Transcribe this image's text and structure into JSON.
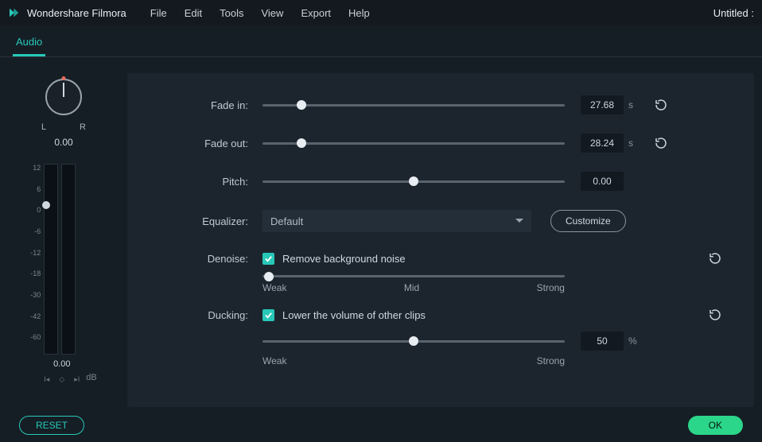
{
  "app": {
    "name": "Wondershare Filmora",
    "doc_title": "Untitled :"
  },
  "menu": [
    "File",
    "Edit",
    "Tools",
    "View",
    "Export",
    "Help"
  ],
  "tab": {
    "label": "Audio"
  },
  "pan": {
    "left": "L",
    "right": "R",
    "value": "0.00"
  },
  "meter": {
    "ticks": [
      "12",
      "6",
      "0",
      "-6",
      "-12",
      "-18",
      "-30",
      "-42",
      "-60",
      ""
    ],
    "value": "0.00",
    "unit": "dB",
    "nav": {
      "prev": "I◂",
      "key": "◇",
      "next": "▸I"
    }
  },
  "controls": {
    "fade_in": {
      "label": "Fade in:",
      "value": "27.68",
      "unit": "s",
      "pos": 13
    },
    "fade_out": {
      "label": "Fade out:",
      "value": "28.24",
      "unit": "s",
      "pos": 13
    },
    "pitch": {
      "label": "Pitch:",
      "value": "0.00",
      "pos": 50
    },
    "equalizer": {
      "label": "Equalizer:",
      "selected": "Default",
      "customize": "Customize"
    },
    "denoise": {
      "label": "Denoise:",
      "check_label": "Remove background noise",
      "checked": true,
      "pos": 2,
      "scale": {
        "weak": "Weak",
        "mid": "Mid",
        "strong": "Strong"
      }
    },
    "ducking": {
      "label": "Ducking:",
      "check_label": "Lower the volume of other clips",
      "checked": true,
      "pos": 50,
      "value": "50",
      "unit": "%",
      "scale": {
        "weak": "Weak",
        "strong": "Strong"
      }
    }
  },
  "footer": {
    "reset": "RESET",
    "ok": "OK"
  }
}
